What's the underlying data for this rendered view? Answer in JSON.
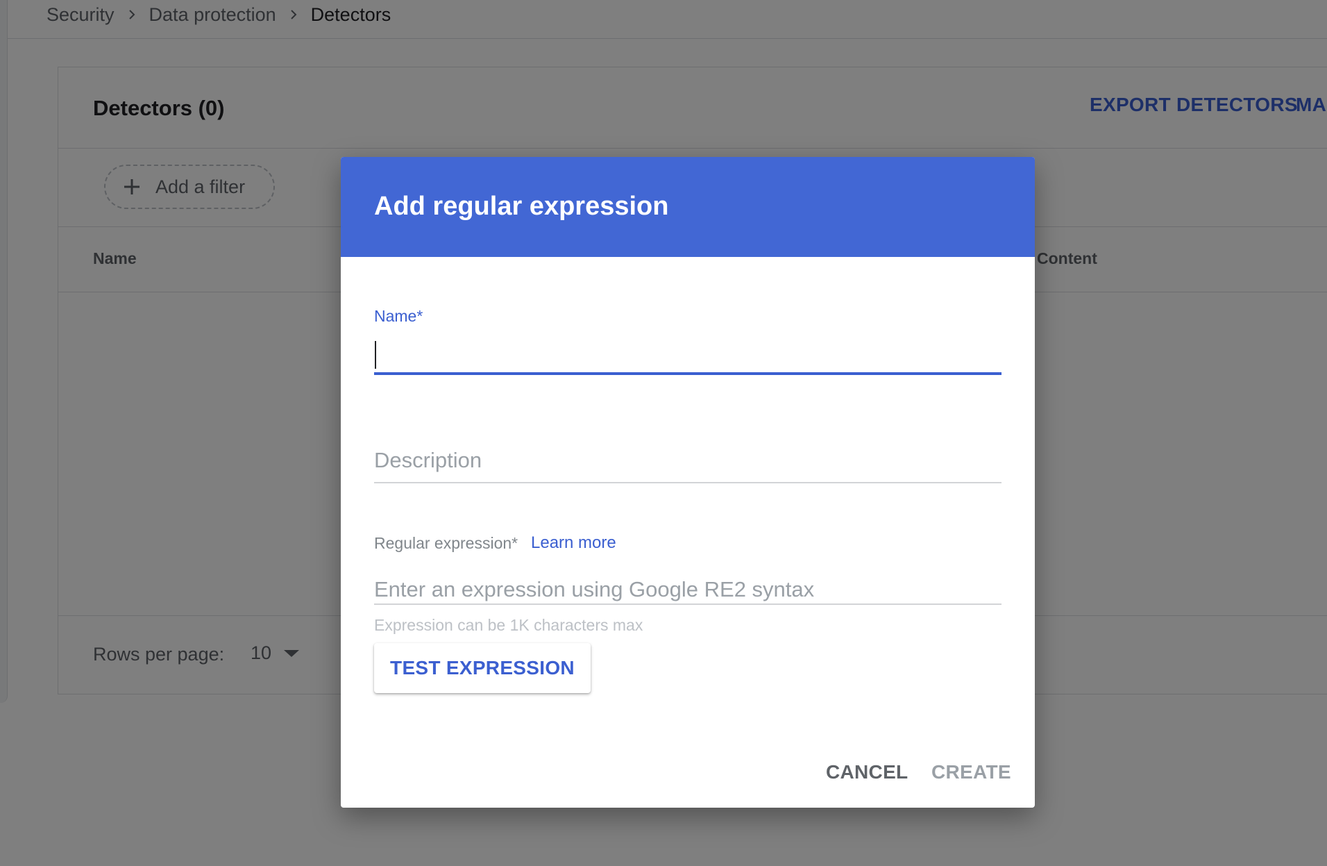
{
  "breadcrumb": {
    "items": [
      "Security",
      "Data protection",
      "Detectors"
    ]
  },
  "card": {
    "title": "Detectors (0)",
    "actions": [
      "EXPORT DETECTORS",
      "MANAGE"
    ],
    "add_filter_label": "Add a filter",
    "columns": [
      "Name",
      "Content"
    ],
    "rows_per_page_label": "Rows per page:",
    "rows_per_page_value": "10"
  },
  "dialog": {
    "title": "Add regular expression",
    "name_label": "Name*",
    "name_value": "",
    "description_placeholder": "Description",
    "regex_label": "Regular expression*",
    "learn_more": "Learn more",
    "regex_placeholder": "Enter an expression using Google RE2 syntax",
    "helper_text": "Expression can be 1K characters max",
    "test_button": "TEST EXPRESSION",
    "cancel_button": "CANCEL",
    "create_button": "CREATE"
  },
  "colors": {
    "accent": "#3b5fd0",
    "dialog_header": "#4267d4",
    "scrim": "rgba(0,0,0,0.5)"
  },
  "icons": {
    "breadcrumb_separator": "chevron-right-icon",
    "add_filter": "plus-icon",
    "rows_dropdown": "caret-down-icon"
  }
}
